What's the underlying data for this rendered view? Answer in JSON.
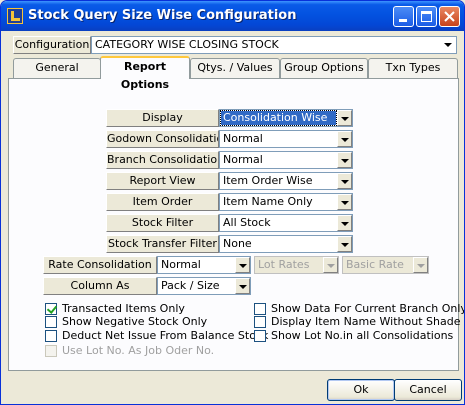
{
  "window": {
    "title": "Stock Query Size Wise Configuration"
  },
  "configuration": {
    "label": "Configuration",
    "value": "CATEGORY WISE CLOSING STOCK"
  },
  "tabs": [
    {
      "label": "General",
      "active": false
    },
    {
      "label": "Report Options",
      "active": true
    },
    {
      "label": "Qtys. / Values",
      "active": false
    },
    {
      "label": "Group Options",
      "active": false
    },
    {
      "label": "Txn Types",
      "active": false
    }
  ],
  "options": {
    "display": {
      "label": "Display",
      "value": "Consolidation Wise"
    },
    "godown_consolidation": {
      "label": "Godown Consolidation",
      "value": "Normal"
    },
    "branch_consolidation": {
      "label": "Branch Consolidation",
      "value": "Normal"
    },
    "report_view": {
      "label": "Report View",
      "value": "Item Order Wise"
    },
    "item_order": {
      "label": "Item Order",
      "value": "Item Name Only"
    },
    "stock_filter": {
      "label": "Stock Filter",
      "value": "All Stock"
    },
    "stock_transfer_filter": {
      "label": "Stock Transfer Filter",
      "value": "None"
    },
    "rate_consolidation": {
      "label": "Rate Consolidation",
      "value": "Normal",
      "lot_rates": "Lot Rates",
      "basic_rate": "Basic Rate"
    },
    "column_as": {
      "label": "Column As",
      "value": "Pack / Size"
    }
  },
  "checkboxes_left": [
    {
      "label": "Transacted Items Only",
      "checked": true,
      "enabled": true
    },
    {
      "label": "Show Negative Stock Only",
      "checked": false,
      "enabled": true
    },
    {
      "label": "Deduct Net Issue From Balance Stock",
      "checked": false,
      "enabled": true
    },
    {
      "label": "Use Lot No. As Job Oder No.",
      "checked": false,
      "enabled": false
    }
  ],
  "checkboxes_right": [
    {
      "label": "Show Data For Current Branch Only",
      "checked": false,
      "enabled": true
    },
    {
      "label": "Display Item Name Without Shade",
      "checked": false,
      "enabled": true
    },
    {
      "label": "Show Lot No.in all Consolidations",
      "checked": false,
      "enabled": true
    }
  ],
  "buttons": {
    "ok": "Ok",
    "cancel": "Cancel"
  },
  "colors": {
    "titlebar": "#0352e0",
    "selection": "#316ac5",
    "active_tab_accent": "#ffc83c"
  }
}
